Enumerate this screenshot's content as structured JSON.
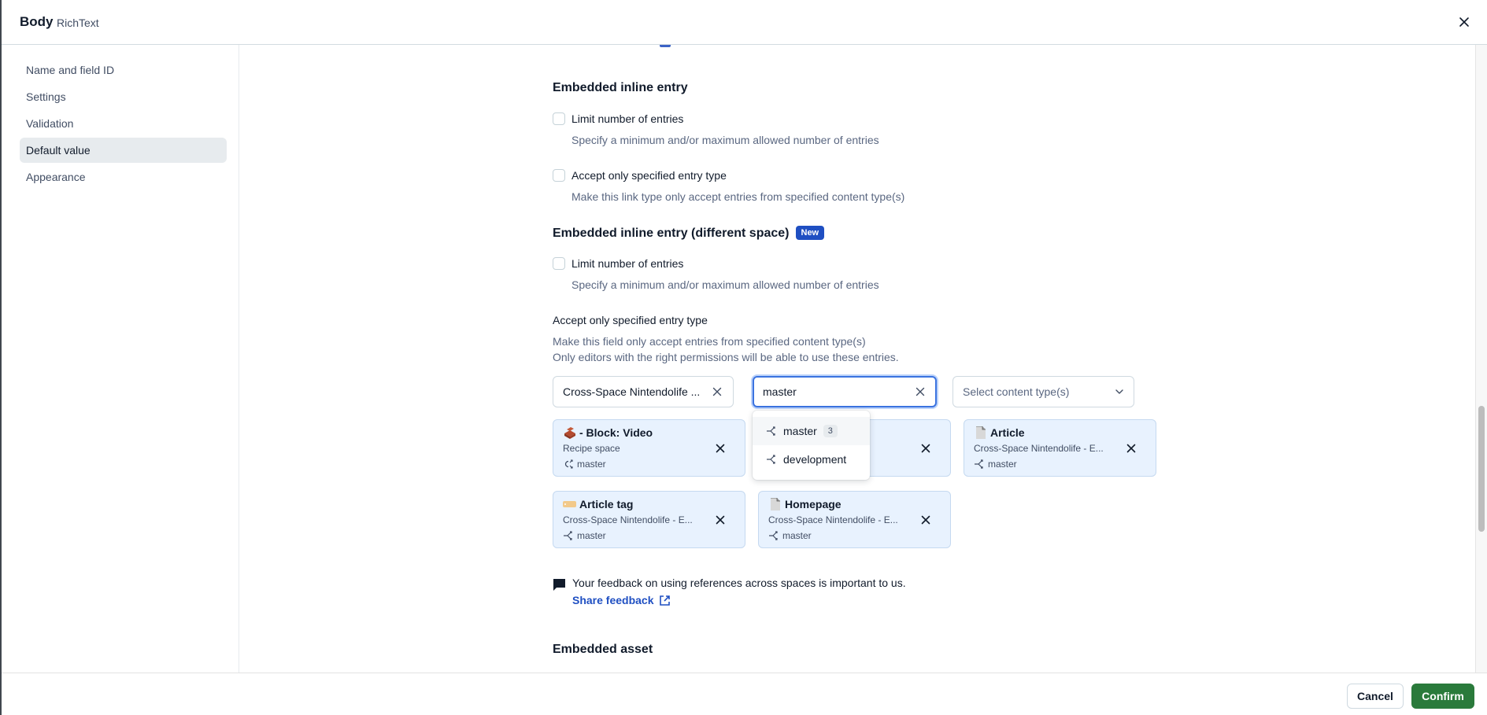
{
  "header": {
    "title": "Body",
    "subtitle": "RichText"
  },
  "sidebar": {
    "items": [
      {
        "label": "Name and field ID",
        "active": false
      },
      {
        "label": "Settings",
        "active": false
      },
      {
        "label": "Validation",
        "active": false
      },
      {
        "label": "Default value",
        "active": true
      },
      {
        "label": "Appearance",
        "active": false
      }
    ]
  },
  "sections": {
    "embedded_inline_entry": {
      "title": "Embedded inline entry",
      "limit_label": "Limit number of entries",
      "limit_help": "Specify a minimum and/or maximum allowed number of entries",
      "limit_checked": false,
      "accept_label": "Accept only specified entry type",
      "accept_help": "Make this link type only accept entries from specified content type(s)",
      "accept_checked": false
    },
    "embedded_inline_entry_different_space": {
      "title": "Embedded inline entry (different space)",
      "badge": "New",
      "limit_label": "Limit number of entries",
      "limit_help": "Specify a minimum and/or maximum allowed number of entries",
      "limit_checked": false,
      "accept_title": "Accept only specified entry type",
      "accept_help_1": "Make this field only accept entries from specified content type(s)",
      "accept_help_2": "Only editors with the right permissions will be able to use these entries.",
      "space_select": {
        "value": "Cross-Space Nintendolife ..."
      },
      "environment_input": {
        "value": "master"
      },
      "content_type_select": {
        "placeholder": "Select content type(s)"
      },
      "environment_dropdown": [
        {
          "label": "master",
          "count": "3"
        },
        {
          "label": "development",
          "count": null
        }
      ],
      "cards": [
        {
          "icon": "brick-icon",
          "title": "- Block: Video",
          "space": "Recipe space",
          "environment": "master"
        },
        {
          "icon": "hidden",
          "title": "",
          "space": "",
          "environment": ""
        },
        {
          "icon": "page-icon",
          "title": "Article",
          "space": "Cross-Space Nintendolife - E...",
          "environment": "master"
        },
        {
          "icon": "tag-icon",
          "title": "Article tag",
          "space": "Cross-Space Nintendolife - E...",
          "environment": "master"
        },
        {
          "icon": "page-icon",
          "title": "Homepage",
          "space": "Cross-Space Nintendolife - E...",
          "environment": "master"
        }
      ]
    },
    "feedback": {
      "text": "Your feedback on using references across spaces is important to us.",
      "link_label": "Share feedback"
    },
    "embedded_asset": {
      "title": "Embedded asset"
    }
  },
  "footer": {
    "cancel_label": "Cancel",
    "confirm_label": "Confirm"
  },
  "colors": {
    "primary_blue": "#1f4fc2",
    "confirm_green": "#2a7a3b",
    "card_bg": "#e8f2fe",
    "focus_ring": "#3b73e0"
  }
}
